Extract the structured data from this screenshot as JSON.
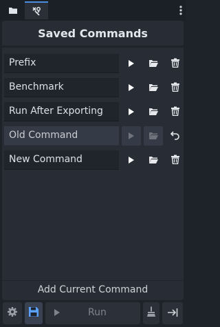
{
  "panel": {
    "title": "Saved Commands",
    "add_label": "Add Current Command"
  },
  "commands": [
    {
      "name": "Prefix",
      "state": "normal"
    },
    {
      "name": "Benchmark",
      "state": "normal"
    },
    {
      "name": "Run After Exporting",
      "state": "normal"
    },
    {
      "name": "Old Command",
      "state": "dimmed"
    },
    {
      "name": "New Command",
      "state": "normal"
    }
  ],
  "bottom": {
    "run_label": "Run"
  },
  "colors": {
    "accent": "#4a8fe0",
    "panel": "#272c35",
    "background": "#1e2229"
  },
  "icons": [
    "folder-icon",
    "shortcut-tool-icon",
    "kebab-icon",
    "play-icon",
    "folder-open-icon",
    "trash-icon",
    "undo-icon",
    "gear-icon",
    "save-icon",
    "broom-icon",
    "exit-icon"
  ]
}
